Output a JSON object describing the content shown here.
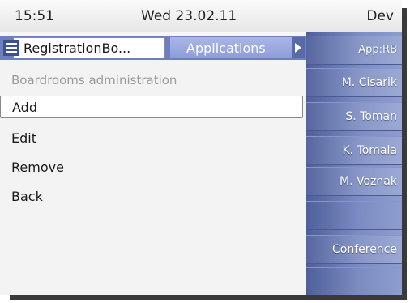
{
  "status_bar": {
    "time": "15:51",
    "date": "Wed 23.02.11",
    "device": "Dev"
  },
  "tabs": {
    "active_label": "RegistrationBo...",
    "applications_label": "Applications"
  },
  "main": {
    "subtitle": "Boardrooms administration",
    "menu": [
      {
        "label": "Add",
        "selected": true
      },
      {
        "label": "Edit"
      },
      {
        "label": "Remove"
      },
      {
        "label": "Back"
      }
    ]
  },
  "softkeys": [
    {
      "label": "App:RB"
    },
    {
      "label": "M. Cisarik"
    },
    {
      "label": "S. Toman"
    },
    {
      "label": "K. Tomala"
    },
    {
      "label": "M. Voznak"
    },
    {
      "label": ""
    },
    {
      "label": "Conference"
    },
    {
      "label": ""
    }
  ],
  "colors": {
    "softkey_bg": "#6e7fbf",
    "tab_bar": "#6e7fbf",
    "selection_border": "#8a8a8a"
  }
}
